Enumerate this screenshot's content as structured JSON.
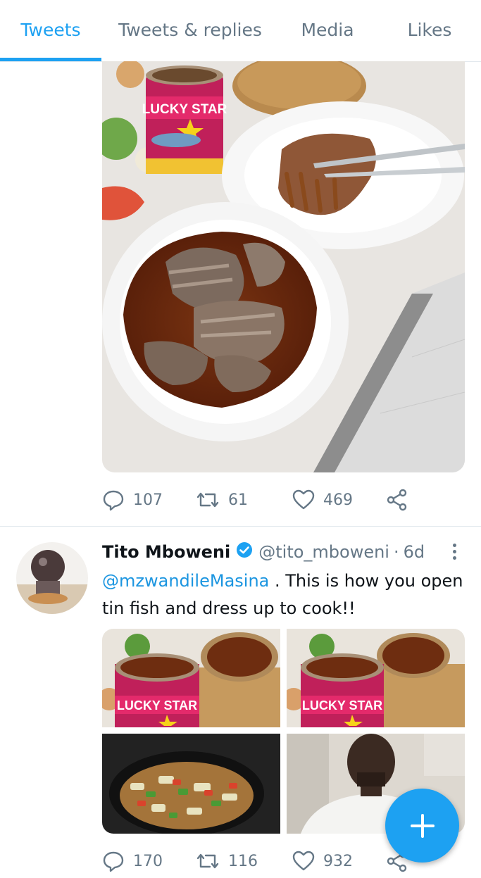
{
  "tabs": [
    {
      "label": "Tweets",
      "active": true
    },
    {
      "label": "Tweets & replies",
      "active": false
    },
    {
      "label": "Media",
      "active": false
    },
    {
      "label": "Likes",
      "active": false
    }
  ],
  "tweet1": {
    "image_can_label": "LUCKY STAR",
    "actions": {
      "replies": "107",
      "retweets": "61",
      "likes": "469"
    }
  },
  "tweet2": {
    "name": "Tito Mboweni",
    "handle": "@tito_mboweni",
    "separator": "·",
    "time": "6d",
    "mention": "@mzwandileMasina",
    "text": " . This is how you open tin fish and dress up to cook!!",
    "can_label": "LUCKY STAR",
    "actions": {
      "replies": "170",
      "retweets": "116",
      "likes": "932"
    }
  },
  "colors": {
    "accent": "#1da1f2",
    "muted": "#657786",
    "divider": "#e1e8ed"
  },
  "icons": [
    "reply-icon",
    "retweet-icon",
    "like-icon",
    "share-icon",
    "verified-icon",
    "more-icon",
    "compose-icon"
  ]
}
